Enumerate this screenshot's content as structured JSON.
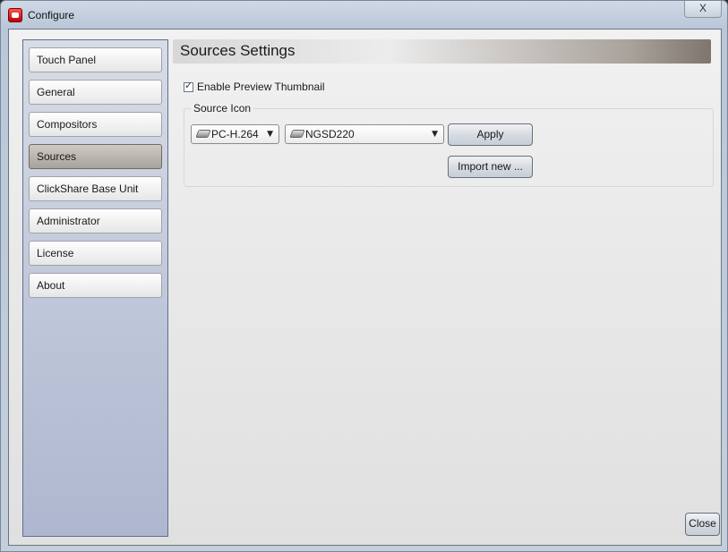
{
  "window": {
    "title": "Configure",
    "close_glyph": "X"
  },
  "sidebar": {
    "items": [
      {
        "label": "Touch Panel",
        "active": false
      },
      {
        "label": "General",
        "active": false
      },
      {
        "label": "Compositors",
        "active": false
      },
      {
        "label": "Sources",
        "active": true
      },
      {
        "label": "ClickShare Base Unit",
        "active": false
      },
      {
        "label": "Administrator",
        "active": false
      },
      {
        "label": "License",
        "active": false
      },
      {
        "label": "About",
        "active": false
      }
    ]
  },
  "content": {
    "header": "Sources Settings",
    "preview": {
      "label": "Enable Preview Thumbnail",
      "checked": true
    },
    "source_icon": {
      "legend": "Source Icon",
      "codec_select": {
        "value": "PC-H.264",
        "icon": "device-icon"
      },
      "source_select": {
        "value": "NGSD220",
        "icon": "device-icon"
      },
      "apply_label": "Apply",
      "import_label": "Import new ..."
    }
  },
  "footer": {
    "close_label": "Close"
  },
  "colors": {
    "active_nav": "#a8a29c",
    "sidebar_border": "#5c6f90"
  }
}
